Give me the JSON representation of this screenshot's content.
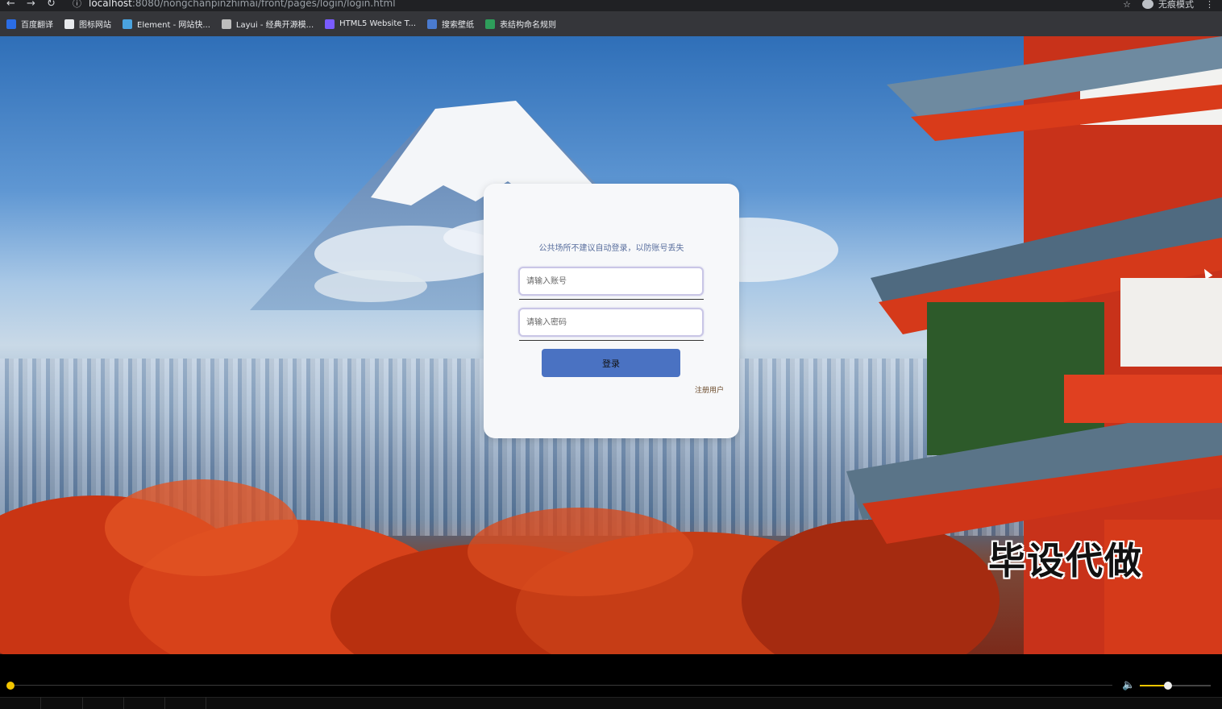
{
  "browser": {
    "url_host": "localhost",
    "url_path": ":8080/nongchanpinzhimai/front/pages/login/login.html",
    "incognito_label": "无痕模式",
    "back_icon": "arrow-left-icon",
    "forward_icon": "arrow-right-icon",
    "reload_icon": "reload-icon",
    "info_icon": "info-icon",
    "star_icon": "star-icon",
    "menu_icon": "kebab-menu-icon"
  },
  "bookmarks": [
    {
      "label": "百度翻译",
      "color": "#2b6de5"
    },
    {
      "label": "图标网站",
      "color": "#e8eaed"
    },
    {
      "label": "Element - 网站快...",
      "color": "#4aa3df"
    },
    {
      "label": "Layui - 经典开源模...",
      "color": "#bdbdbd"
    },
    {
      "label": "HTML5 Website T...",
      "color": "#7a5cff"
    },
    {
      "label": "搜索壁纸",
      "color": "#4a7bd0"
    },
    {
      "label": "表结构命名规则",
      "color": "#2e9e5b"
    }
  ],
  "login": {
    "tip": "公共场所不建议自动登录，以防账号丢失",
    "username_placeholder": "请输入账号",
    "password_placeholder": "请输入密码",
    "login_label": "登录",
    "register_label": "注册用户"
  },
  "watermark": "毕设代做",
  "player": {
    "progress": 0.0,
    "volume": 0.4,
    "accent": "#f2c500"
  }
}
